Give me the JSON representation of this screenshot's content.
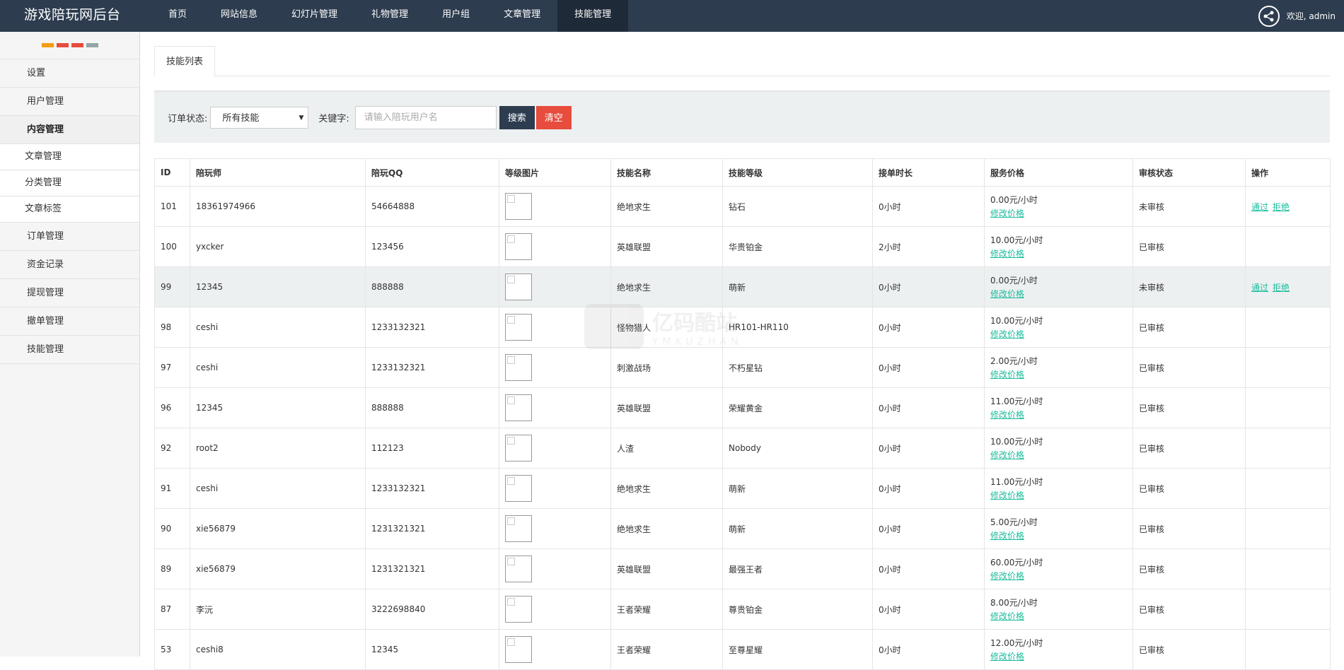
{
  "header": {
    "title": "游戏陪玩网后台",
    "nav": [
      "首页",
      "网站信息",
      "幻灯片管理",
      "礼物管理",
      "用户组",
      "文章管理",
      "技能管理"
    ],
    "active_nav": "技能管理",
    "welcome": "欢迎, admin"
  },
  "sidebar": {
    "dot_colors": [
      "#f39c12",
      "#e74c3c",
      "#e74c3c",
      "#95a5a6"
    ],
    "items": [
      {
        "label": "设置"
      },
      {
        "label": "用户管理"
      },
      {
        "label": "内容管理"
      },
      {
        "label": "文章管理"
      },
      {
        "label": "分类管理"
      },
      {
        "label": "文章标签"
      },
      {
        "label": "订单管理"
      },
      {
        "label": "资金记录"
      },
      {
        "label": "提现管理"
      },
      {
        "label": "撤单管理"
      },
      {
        "label": "技能管理"
      }
    ]
  },
  "main": {
    "tab": "技能列表",
    "filter": {
      "status_label": "订单状态:",
      "status_value": "所有技能",
      "keyword_label": "关键字:",
      "keyword_placeholder": "请输入陪玩用户名",
      "search_button": "搜索",
      "clear_button": "清空"
    },
    "table": {
      "headers": [
        "ID",
        "陪玩师",
        "陪玩QQ",
        "等级图片",
        "技能名称",
        "技能等级",
        "接单时长",
        "服务价格",
        "审核状态",
        "操作"
      ],
      "edit_price_label": "修改价格",
      "approve_label": "通过",
      "reject_label": "拒绝",
      "rows": [
        {
          "id": "101",
          "player": "18361974966",
          "qq": "54664888",
          "skill": "绝地求生",
          "level": "钻石",
          "duration": "0小时",
          "price": "0.00元/小时",
          "status": "未审核",
          "ops": true
        },
        {
          "id": "100",
          "player": "yxcker",
          "qq": "123456",
          "skill": "英雄联盟",
          "level": "华贵铂金",
          "duration": "2小时",
          "price": "10.00元/小时",
          "status": "已审核",
          "ops": false
        },
        {
          "id": "99",
          "player": "12345",
          "qq": "888888",
          "skill": "绝地求生",
          "level": "萌新",
          "duration": "0小时",
          "price": "0.00元/小时",
          "status": "未审核",
          "ops": true
        },
        {
          "id": "98",
          "player": "ceshi",
          "qq": "1233132321",
          "skill": "怪物猎人",
          "level": "HR101-HR110",
          "duration": "0小时",
          "price": "10.00元/小时",
          "status": "已审核",
          "ops": false
        },
        {
          "id": "97",
          "player": "ceshi",
          "qq": "1233132321",
          "skill": "刺激战场",
          "level": "不朽星钻",
          "duration": "0小时",
          "price": "2.00元/小时",
          "status": "已审核",
          "ops": false
        },
        {
          "id": "96",
          "player": "12345",
          "qq": "888888",
          "skill": "英雄联盟",
          "level": "荣耀黄金",
          "duration": "0小时",
          "price": "11.00元/小时",
          "status": "已审核",
          "ops": false
        },
        {
          "id": "92",
          "player": "root2",
          "qq": "112123",
          "skill": "人渣",
          "level": "Nobody",
          "duration": "0小时",
          "price": "10.00元/小时",
          "status": "已审核",
          "ops": false
        },
        {
          "id": "91",
          "player": "ceshi",
          "qq": "1233132321",
          "skill": "绝地求生",
          "level": "萌新",
          "duration": "0小时",
          "price": "11.00元/小时",
          "status": "已审核",
          "ops": false
        },
        {
          "id": "90",
          "player": "xie56879",
          "qq": "1231321321",
          "skill": "绝地求生",
          "level": "萌新",
          "duration": "0小时",
          "price": "5.00元/小时",
          "status": "已审核",
          "ops": false
        },
        {
          "id": "89",
          "player": "xie56879",
          "qq": "1231321321",
          "skill": "英雄联盟",
          "level": "最强王者",
          "duration": "0小时",
          "price": "60.00元/小时",
          "status": "已审核",
          "ops": false
        },
        {
          "id": "87",
          "player": "李沅",
          "qq": "3222698840",
          "skill": "王者荣耀",
          "level": "尊贵铂金",
          "duration": "0小时",
          "price": "8.00元/小时",
          "status": "已审核",
          "ops": false
        },
        {
          "id": "53",
          "player": "ceshi8",
          "qq": "12345",
          "skill": "王者荣耀",
          "level": "至尊星耀",
          "duration": "0小时",
          "price": "12.00元/小时",
          "status": "已审核",
          "ops": false
        }
      ]
    }
  },
  "watermark": {
    "text": "亿码酷站",
    "sub": "YMKUZHAN"
  }
}
